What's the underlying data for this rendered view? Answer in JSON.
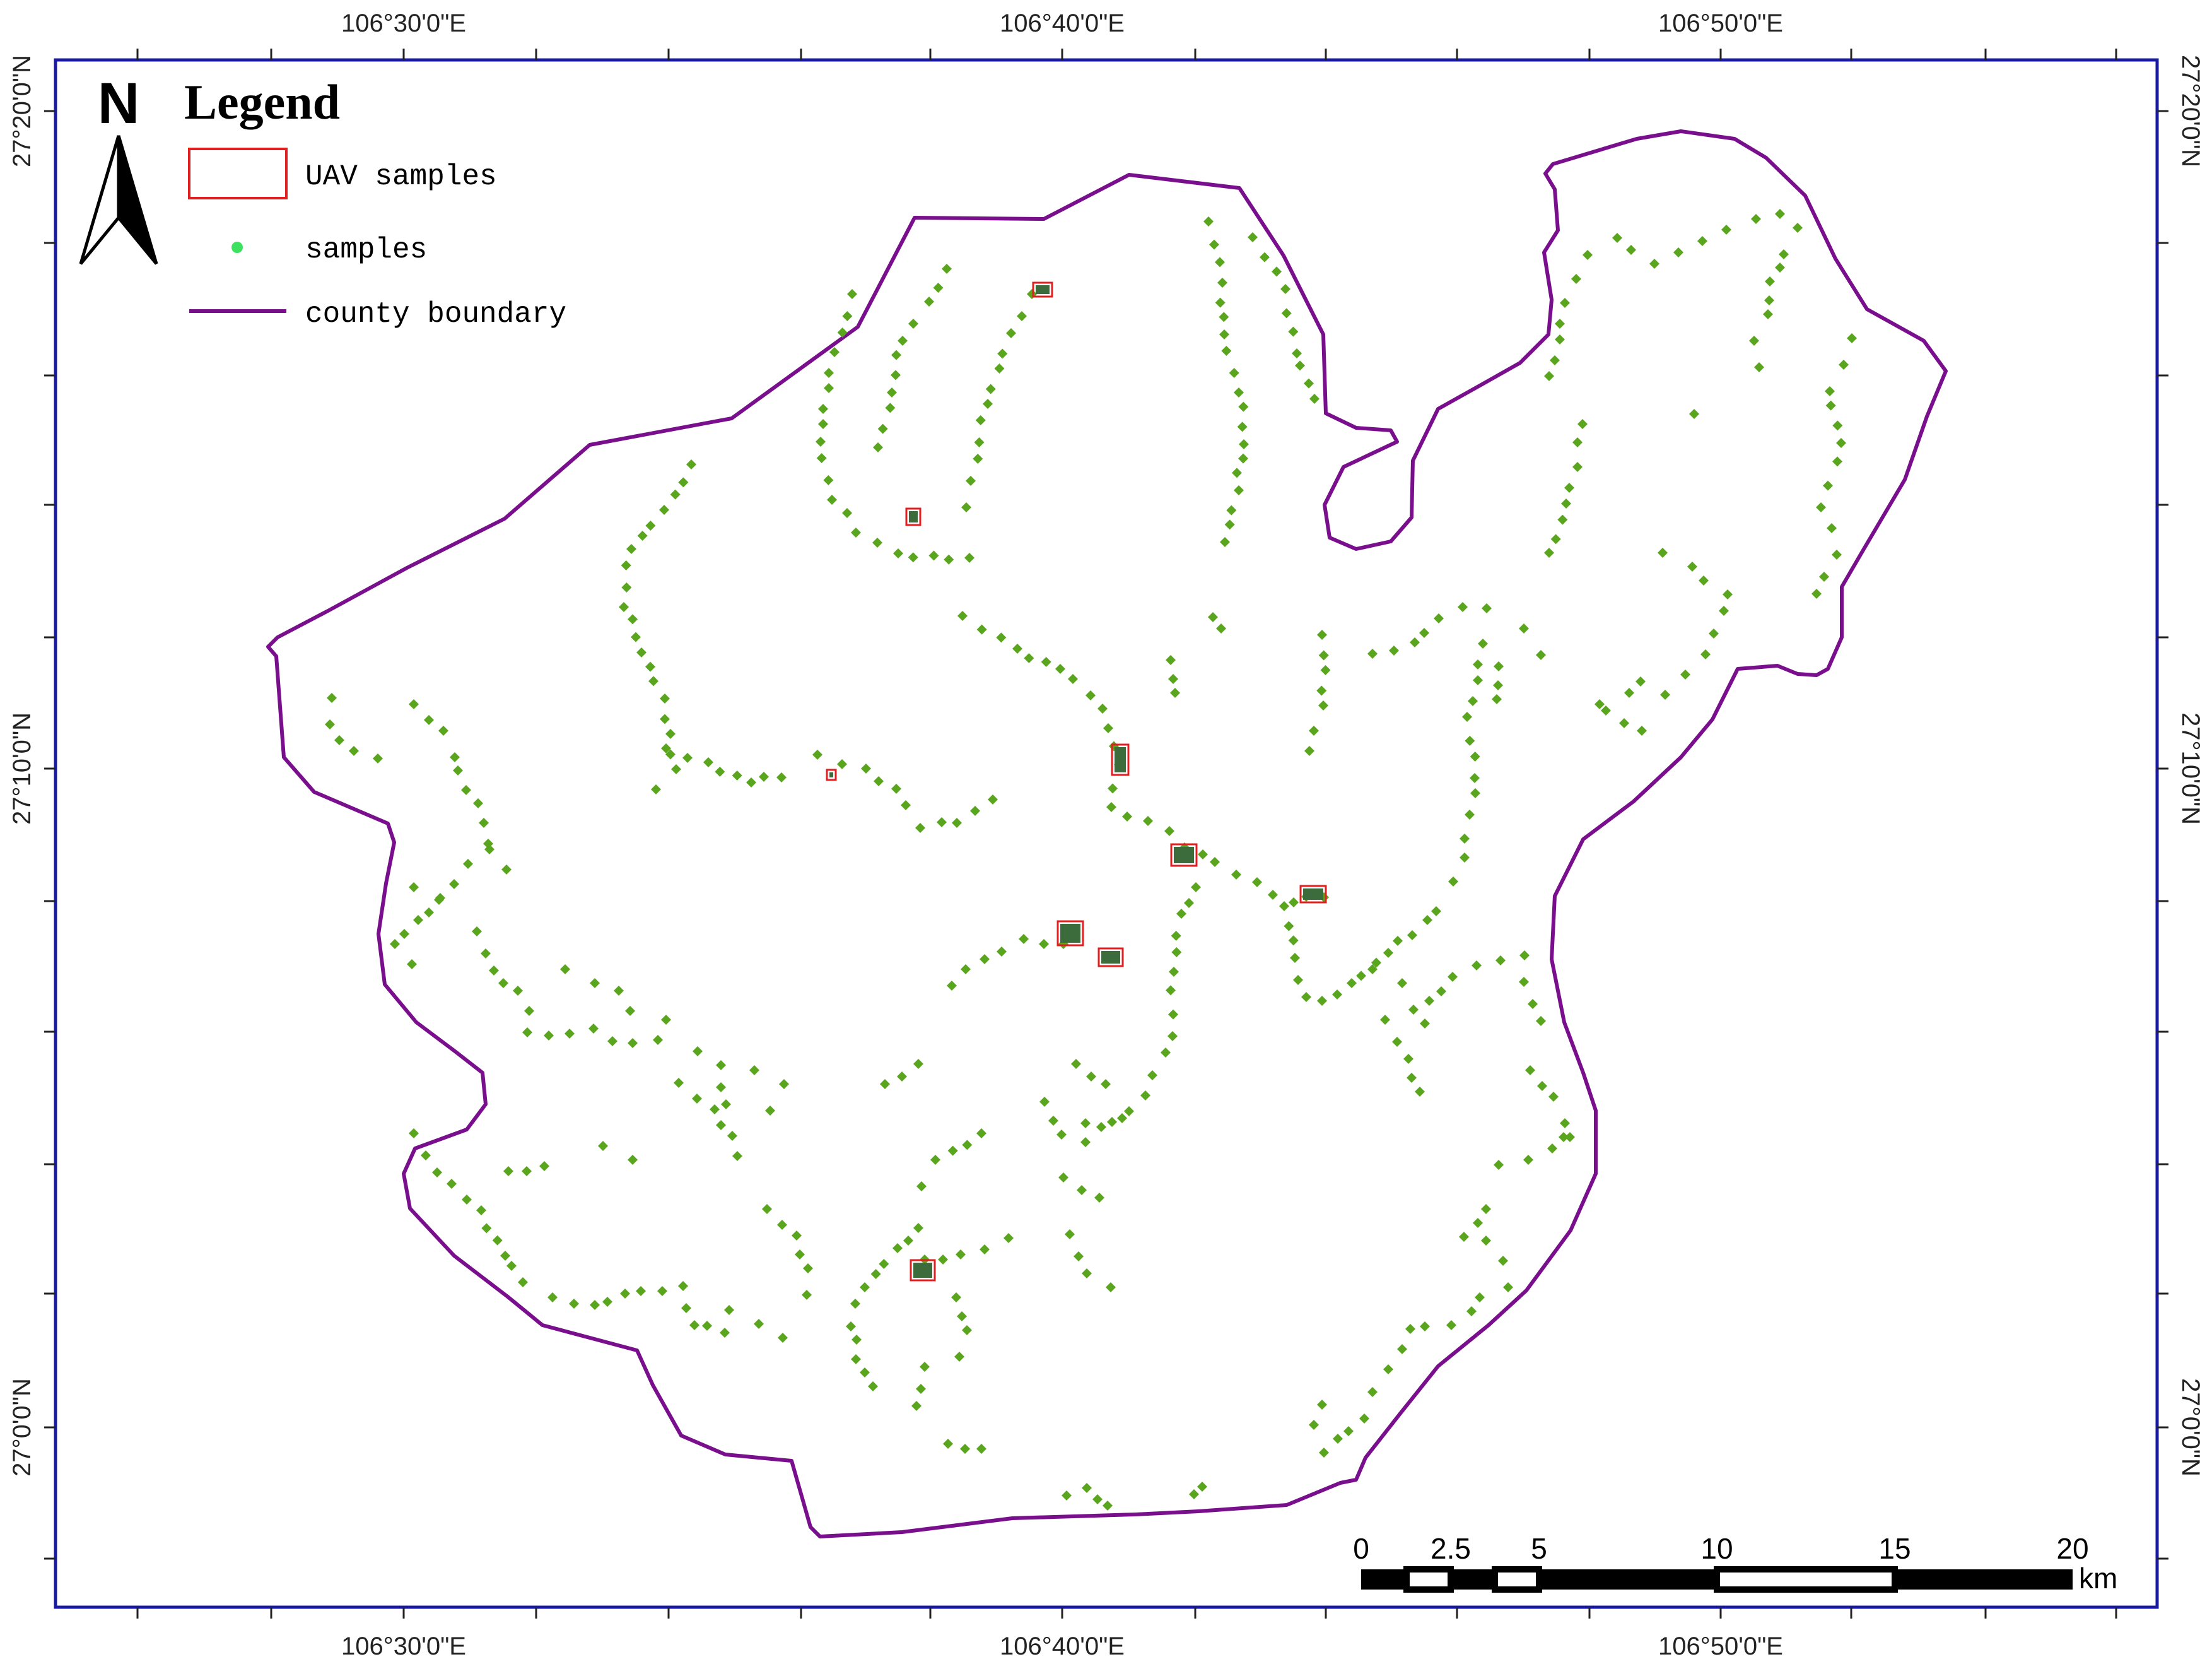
{
  "map": {
    "latitude_labels": [
      "27°20'0\"N",
      "27°10'0\"N",
      "27°0'0\"N"
    ],
    "longitude_labels": [
      "106°30'0\"E",
      "106°40'0\"E",
      "106°50'0\"E"
    ],
    "colors": {
      "frame": "#1a1aa0",
      "boundary": "#7a0f8e",
      "samples": "#5aa51e",
      "uav_box": "#e02020"
    }
  },
  "north_arrow": {
    "label": "N",
    "icon": "north-arrow-icon"
  },
  "legend": {
    "title": "Legend",
    "items": [
      {
        "label": "UAV samples",
        "symbol": "red-rectangle"
      },
      {
        "label": "samples",
        "symbol": "green-dot"
      },
      {
        "label": "county boundary",
        "symbol": "purple-line"
      }
    ]
  },
  "scale_bar": {
    "ticks": [
      "0",
      "2.5",
      "5",
      "10",
      "15",
      "20"
    ],
    "unit": "km"
  }
}
